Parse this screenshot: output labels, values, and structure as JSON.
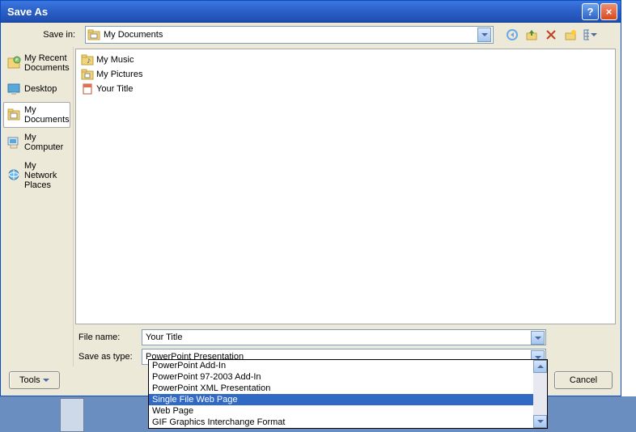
{
  "title": "Save As",
  "savein": {
    "label": "Save in:",
    "value": "My Documents"
  },
  "toolbar_icons": [
    "back-icon",
    "up-icon",
    "delete-icon",
    "new-folder-icon",
    "views-icon"
  ],
  "sidebar": {
    "items": [
      {
        "label": "My Recent Documents"
      },
      {
        "label": "Desktop"
      },
      {
        "label": "My Documents"
      },
      {
        "label": "My Computer"
      },
      {
        "label": "My Network Places"
      }
    ]
  },
  "files": [
    {
      "label": "My Music"
    },
    {
      "label": "My Pictures"
    },
    {
      "label": "Your Title"
    }
  ],
  "filename": {
    "label": "File name:",
    "value": "Your Title"
  },
  "savetype": {
    "label": "Save as type:",
    "value": "PowerPoint Presentation"
  },
  "type_options": [
    "PowerPoint Add-In",
    "PowerPoint 97-2003 Add-In",
    "PowerPoint XML Presentation",
    "Single File Web Page",
    "Web Page",
    "GIF Graphics Interchange Format"
  ],
  "selected_option_index": 3,
  "tools_label": "Tools",
  "cancel_label": "Cancel"
}
